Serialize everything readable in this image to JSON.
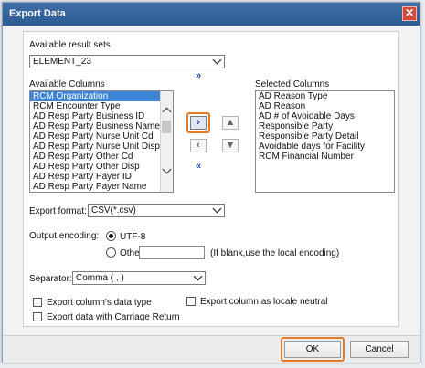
{
  "dialog": {
    "title": "Export Data",
    "close_icon": "close-icon"
  },
  "result_sets": {
    "label": "Available result sets",
    "selected": "ELEMENT_23"
  },
  "available_columns": {
    "label": "Available Columns",
    "items": [
      "RCM Organization",
      "RCM Encounter Type",
      "AD Resp Party Business ID",
      "AD Resp Party Business Name",
      "AD Resp Party Nurse Unit Cd",
      "AD Resp Party Nurse Unit Disp",
      "AD Resp Party Other Cd",
      "AD Resp Party Other Disp",
      "AD Resp Party Payer ID",
      "AD Resp Party Payer Name"
    ],
    "selected_index": 0
  },
  "transfer_buttons": {
    "add_all": "»",
    "add_selected": "›",
    "remove_selected": "‹",
    "remove_all": "«",
    "move_up": "▲",
    "move_down": "▼"
  },
  "selected_columns": {
    "label": "Selected Columns",
    "items": [
      "AD Reason Type",
      "AD Reason",
      "AD # of Avoidable Days",
      "Responsible Party",
      "Responsible Party Detail",
      "Avoidable days for Facility",
      "RCM Financial Number"
    ]
  },
  "export_format": {
    "label": "Export format:",
    "selected": "CSV(*.csv)"
  },
  "output_encoding": {
    "label": "Output encoding:",
    "option_utf8": "UTF-8",
    "option_other": "Other",
    "other_value": "",
    "hint": "(If blank,use the local encoding)",
    "selected": "UTF-8"
  },
  "separator": {
    "label": "Separator:",
    "selected": "Comma ( , )"
  },
  "options": {
    "export_data_type": "Export column's data type",
    "export_locale_neutral": "Export column as locale neutral",
    "export_carriage_return": "Export data with Carriage Return"
  },
  "footer": {
    "ok_label": "OK",
    "cancel_label": "Cancel"
  },
  "colors": {
    "title_bar": "#2d5a92",
    "selection": "#3d84d6",
    "highlight": "#e37b2b"
  }
}
